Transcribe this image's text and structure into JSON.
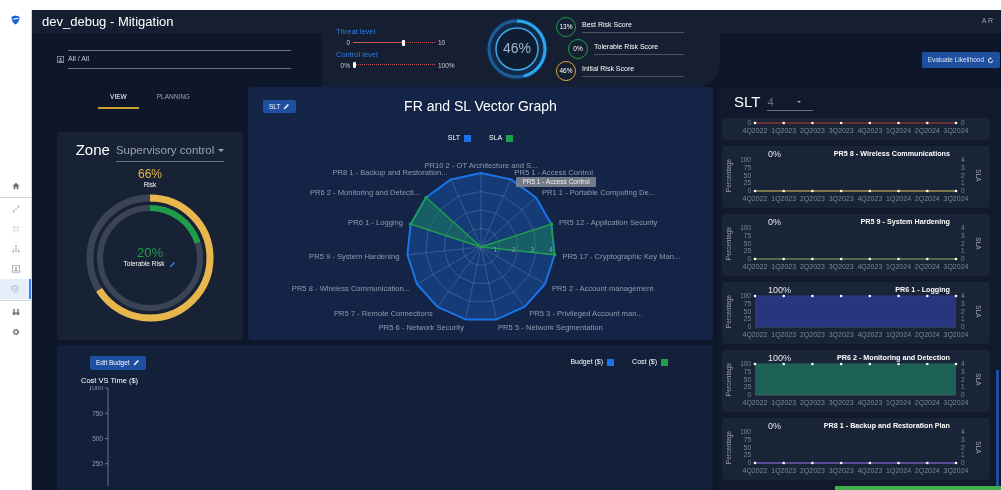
{
  "window": {
    "title": "dev_debug - Mitigation",
    "user_initials": "A R"
  },
  "sidebar": {
    "groups": [
      {
        "items": [
          {
            "kind": "home",
            "selected": false
          }
        ]
      },
      {
        "items": [
          {
            "kind": "network",
            "selected": false
          },
          {
            "kind": "grid",
            "selected": false
          },
          {
            "kind": "hierarchy",
            "selected": false
          },
          {
            "kind": "card",
            "selected": false
          },
          {
            "kind": "shield",
            "selected": true
          }
        ]
      },
      {
        "items": [
          {
            "kind": "people",
            "selected": false
          },
          {
            "kind": "gear",
            "selected": false
          }
        ]
      }
    ]
  },
  "filter": {
    "value": "All / All"
  },
  "threat_level": {
    "label": "Threat level",
    "min": "0",
    "max": "10",
    "level": 0.62
  },
  "control_level": {
    "label": "Control level",
    "min": "0%",
    "max": "100%",
    "level": 0.02
  },
  "risk_gauge": {
    "value": "46%",
    "level": 0.46
  },
  "scores": [
    {
      "value": "13%",
      "label": "Best Risk Score",
      "color": "#1e9e4a"
    },
    {
      "value": "0%",
      "label": "Tolerable Risk Score",
      "color": "#1e9e4a"
    },
    {
      "value": "46%",
      "label": "Initial Risk Score",
      "color": "#e0a83a"
    }
  ],
  "evaluate_button": "Evaluate Likelihood",
  "tabs": [
    {
      "label": "VIEW",
      "selected": true
    },
    {
      "label": "PLANNING",
      "selected": false
    }
  ],
  "zone": {
    "label": "Zone",
    "value": "Supervisory control",
    "risk": {
      "value": "66%",
      "label": "Risk",
      "level": 0.66
    },
    "tolerable": {
      "value": "20%",
      "label": "Tolerable Risk",
      "level": 0.2
    }
  },
  "vector_graph": {
    "button": "SLT",
    "title": "FR and SL Vector Graph",
    "tooltip": "PR5 1 - Access Control",
    "legend": [
      {
        "name": "SLT",
        "color": "#1a73e8"
      },
      {
        "name": "SLA",
        "color": "#1e9e4a"
      }
    ],
    "ticks": [
      "1",
      "2",
      "3",
      "4"
    ],
    "left_axes": [
      {
        "label": "PR8 1 - Backup and Restoration...",
        "sla_reached": false
      },
      {
        "label": "PR6 2 - Monitoring and Detecti...",
        "sla_reached": true
      },
      {
        "label": "PR6 1 - Logging",
        "sla_reached": true
      },
      {
        "label": "PR5 9 - System Hardening",
        "sla_reached": false
      },
      {
        "label": "PR5 8 - Wireless Communication...",
        "sla_reached": false
      },
      {
        "label": "PR5 7 - Remote Connections",
        "sla_reached": false
      },
      {
        "label": "PR5 6 - Network Security",
        "sla_reached": false
      }
    ],
    "right_axes": [
      {
        "label": "PR10 2 - OT Architecture and S...",
        "sla_reached": false
      },
      {
        "label": "PR5 1 - Access Control",
        "sla_reached": false
      },
      {
        "label": "PR1 1 - Portable Computing De...",
        "sla_reached": false
      },
      {
        "label": "PR5 12 - Application Security",
        "sla_reached": true
      },
      {
        "label": "PR5 17 - Cryptographic Key Man...",
        "sla_reached": true
      },
      {
        "label": "PR5 2 - Account management",
        "sla_reached": false
      },
      {
        "label": "PR5 3 - Privileged Account man...",
        "sla_reached": false
      },
      {
        "label": "PR5 5 - Network Segmentation",
        "sla_reached": false
      }
    ]
  },
  "budget": {
    "button": "Edit Budget",
    "legend": [
      {
        "name": "Budget ($)",
        "color": "#1a73e8"
      },
      {
        "name": "Cost ($)",
        "color": "#1e9e4a"
      }
    ],
    "chart_title": "Cost VS Time ($)",
    "yticks": [
      "1000",
      "750",
      "500",
      "250"
    ]
  },
  "slt_panel": {
    "label": "SLT",
    "value": "4",
    "partial_chart": {
      "x_labels": [
        "4Q2022",
        "1Q2023",
        "2Q2023",
        "3Q2023",
        "4Q2023",
        "1Q2024",
        "2Q2024",
        "3Q2024"
      ],
      "left_tick": "0",
      "right_tick": "0"
    },
    "charts": [
      {
        "percent": "0%",
        "sla_axis": {
          "label": "SLA",
          "ticks": [
            "4",
            "3",
            "2",
            "1",
            "0"
          ]
        },
        "chart_data": {
          "type": "line",
          "title": "PR5 8 - Wireless Communications",
          "ylabel": "Percentage",
          "categories": [
            "4Q2022",
            "1Q2023",
            "2Q2023",
            "3Q2023",
            "4Q2023",
            "1Q2024",
            "2Q2024",
            "3Q2024"
          ],
          "ylim": [
            0,
            100
          ],
          "yticks": [
            0,
            25,
            50,
            75,
            100
          ],
          "series": [
            {
              "color": "#9a8a4a",
              "values": [
                0,
                0,
                0,
                0,
                0,
                0,
                0,
                0
              ]
            }
          ]
        }
      },
      {
        "percent": "0%",
        "sla_axis": {
          "label": "SLA",
          "ticks": [
            "4",
            "3",
            "2",
            "1",
            "0"
          ]
        },
        "chart_data": {
          "type": "line",
          "title": "PR5 9 - System Hardening",
          "ylabel": "Percentage",
          "categories": [
            "4Q2022",
            "1Q2023",
            "2Q2023",
            "3Q2023",
            "4Q2023",
            "1Q2024",
            "2Q2024",
            "3Q2024"
          ],
          "ylim": [
            0,
            100
          ],
          "yticks": [
            0,
            25,
            50,
            75,
            100
          ],
          "series": [
            {
              "color": "#5e7a4a",
              "values": [
                0,
                0,
                0,
                0,
                0,
                0,
                0,
                0
              ]
            }
          ]
        }
      },
      {
        "percent": "100%",
        "sla_axis": {
          "label": "SLA",
          "ticks": [
            "4",
            "3",
            "2",
            "1",
            "0"
          ]
        },
        "chart_data": {
          "type": "area",
          "title": "PR6 1 - Logging",
          "ylabel": "Percentage",
          "categories": [
            "4Q2022",
            "1Q2023",
            "2Q2023",
            "3Q2023",
            "4Q2023",
            "1Q2024",
            "2Q2024",
            "3Q2024"
          ],
          "ylim": [
            0,
            100
          ],
          "yticks": [
            0,
            25,
            50,
            75,
            100
          ],
          "series": [
            {
              "color": "#2a3a8c",
              "values": [
                100,
                100,
                100,
                100,
                100,
                100,
                100,
                100
              ]
            }
          ]
        }
      },
      {
        "percent": "100%",
        "sla_axis": {
          "label": "SLA",
          "ticks": [
            "4",
            "3",
            "2",
            "1",
            "0"
          ]
        },
        "chart_data": {
          "type": "area",
          "title": "PR6 2 - Monitoring and Detection",
          "ylabel": "Percentage",
          "categories": [
            "4Q2022",
            "1Q2023",
            "2Q2023",
            "3Q2023",
            "4Q2023",
            "1Q2024",
            "2Q2024",
            "3Q2024"
          ],
          "ylim": [
            0,
            100
          ],
          "yticks": [
            0,
            25,
            50,
            75,
            100
          ],
          "series": [
            {
              "color": "#1f6b5c",
              "values": [
                100,
                100,
                100,
                100,
                100,
                100,
                100,
                100
              ]
            }
          ]
        }
      },
      {
        "percent": "0%",
        "sla_axis": {
          "label": "SLA",
          "ticks": [
            "4",
            "3",
            "2",
            "1",
            "0"
          ]
        },
        "chart_data": {
          "type": "line",
          "title": "PR8 1 - Backup and Restoration Plan",
          "ylabel": "Percentage",
          "categories": [
            "4Q2022",
            "1Q2023",
            "2Q2023",
            "3Q2023",
            "4Q2023",
            "1Q2024",
            "2Q2024",
            "3Q2024"
          ],
          "ylim": [
            0,
            100
          ],
          "yticks": [
            0,
            25,
            50,
            75,
            100
          ],
          "series": [
            {
              "color": "#6a4fb0",
              "values": [
                0,
                0,
                0,
                0,
                0,
                0,
                0,
                0
              ]
            }
          ]
        }
      }
    ]
  }
}
